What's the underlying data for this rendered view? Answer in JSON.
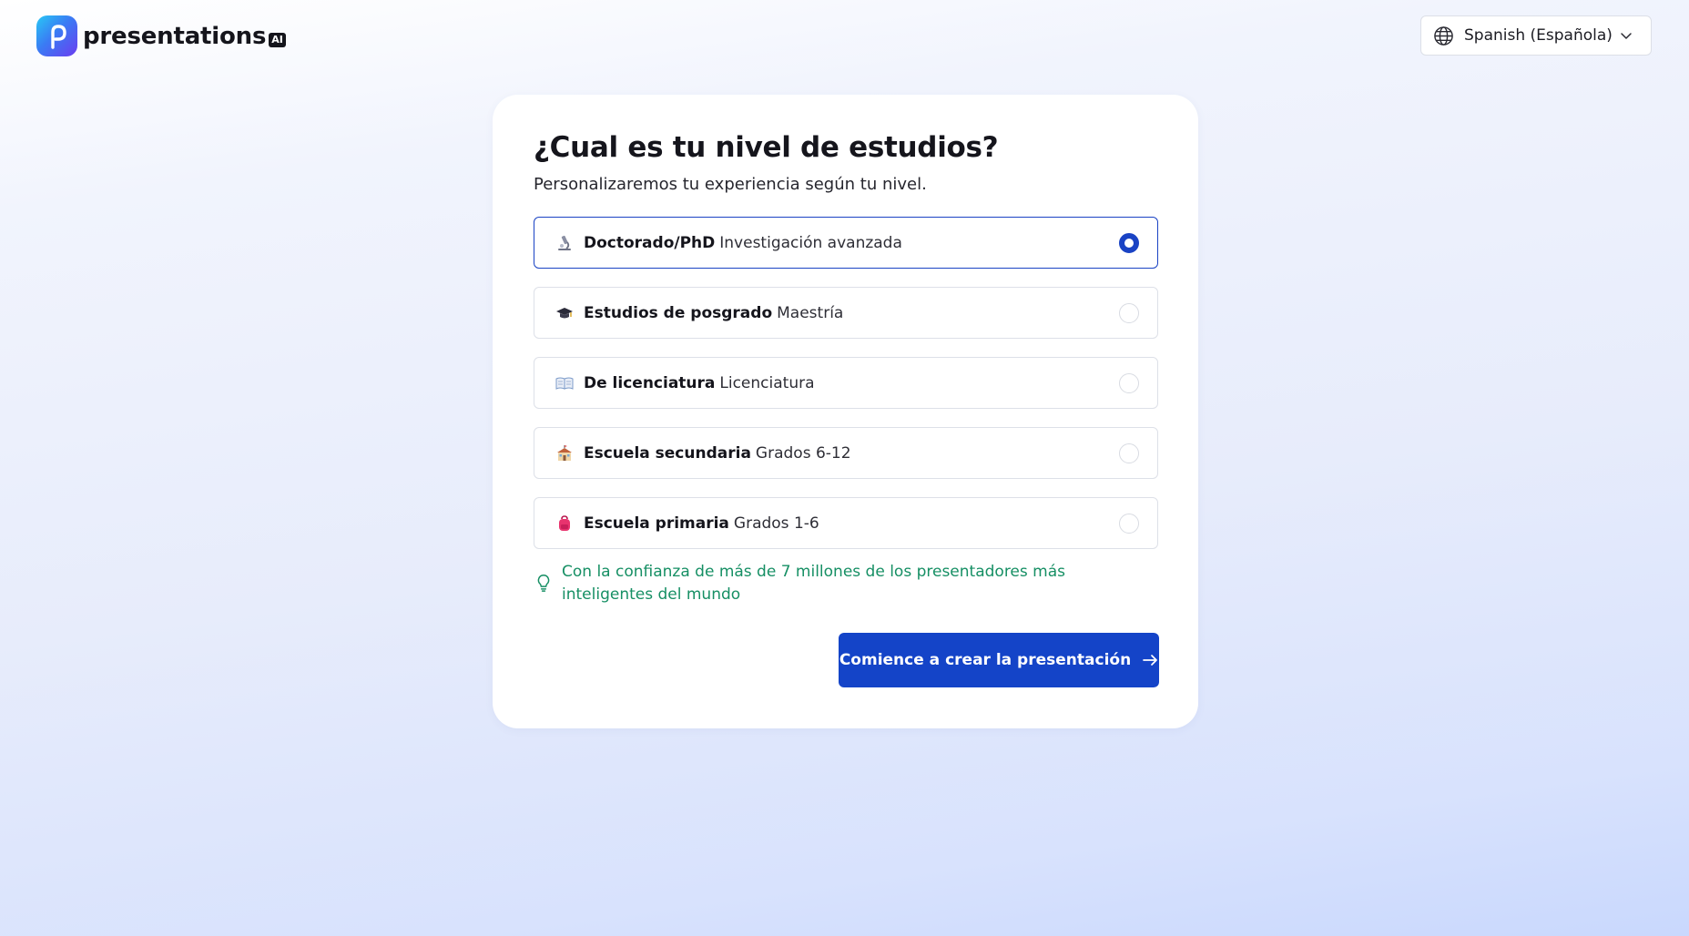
{
  "header": {
    "brand": {
      "name": "presentations",
      "suffix": "AI",
      "icon": "presentations-logo-icon"
    },
    "language": {
      "icon": "globe-icon",
      "label": "Spanish (Española)",
      "chevron_icon": "chevron-down-icon"
    }
  },
  "card": {
    "title": "¿Cual es tu nivel de estudios?",
    "subtitle": "Personalizaremos tu experiencia según tu nivel.",
    "options": [
      {
        "icon": "microscope-icon",
        "title": "Doctorado/PhD",
        "detail": "Investigación avanzada",
        "selected": true
      },
      {
        "icon": "graduation-cap-icon",
        "title": "Estudios de posgrado",
        "detail": "Maestría",
        "selected": false
      },
      {
        "icon": "open-book-icon",
        "title": "De licenciatura",
        "detail": "Licenciatura",
        "selected": false
      },
      {
        "icon": "school-building-icon",
        "title": "Escuela secundaria",
        "detail": "Grados 6-12",
        "selected": false
      },
      {
        "icon": "backpack-icon",
        "title": "Escuela primaria",
        "detail": "Grados 1-6",
        "selected": false
      }
    ],
    "trust": {
      "icon": "lightbulb-icon",
      "text": "Con la confianza de más de 7 millones de los presentadores más inteligentes del mundo"
    },
    "cta": {
      "label": "Comience a crear la presentación",
      "icon": "arrow-right-icon"
    }
  },
  "colors": {
    "accent": "#1444c8",
    "selected_border": "#1a43c4",
    "trust_text": "#168f64",
    "title_text": "#15151c"
  }
}
